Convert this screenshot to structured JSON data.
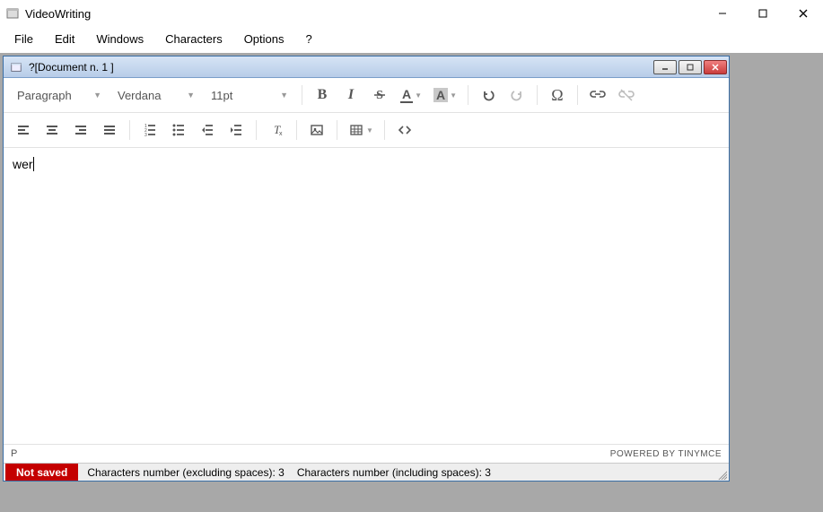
{
  "app": {
    "title": "VideoWriting"
  },
  "menubar": {
    "file": "File",
    "edit": "Edit",
    "windows": "Windows",
    "characters": "Characters",
    "options": "Options",
    "help": "?"
  },
  "document": {
    "title": "?[Document n. 1 ]"
  },
  "toolbar": {
    "format_select": "Paragraph",
    "font_select": "Verdana",
    "size_select": "11pt"
  },
  "editor": {
    "content": "wer",
    "path": "P"
  },
  "status": {
    "powered": "POWERED BY TINYMCE"
  },
  "bottom": {
    "save_state": "Not saved",
    "chars_excl_label": "Characters number (excluding spaces):",
    "chars_excl_value": "3",
    "chars_incl_label": "Characters number (including spaces):",
    "chars_incl_value": "3"
  }
}
